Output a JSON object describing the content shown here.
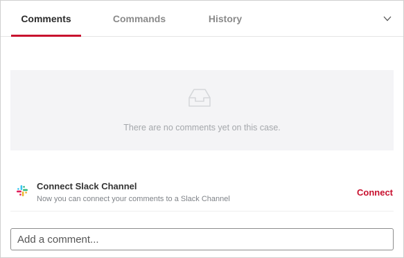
{
  "tabs": [
    {
      "label": "Comments",
      "active": true
    },
    {
      "label": "Commands",
      "active": false
    },
    {
      "label": "History",
      "active": false
    }
  ],
  "empty_state": {
    "icon": "inbox-tray-icon",
    "message": "There are no comments yet on this case."
  },
  "slack": {
    "icon": "slack-icon",
    "title": "Connect Slack Channel",
    "description": "Now you can connect your comments to a Slack Channel",
    "action_label": "Connect"
  },
  "comment_input": {
    "placeholder": "Add a comment...",
    "value": ""
  },
  "colors": {
    "accent": "#c8102e",
    "empty_bg": "#f4f4f6"
  }
}
